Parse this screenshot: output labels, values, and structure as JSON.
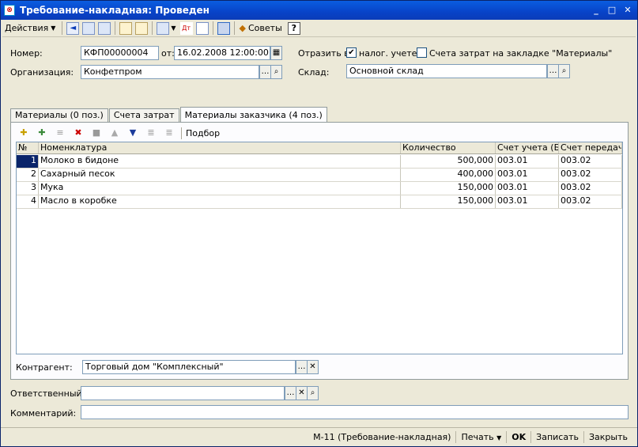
{
  "window": {
    "title": "Требование-накладная: Проведен"
  },
  "toolbar": {
    "actions_label": "Действия",
    "tips_label": "Советы",
    "help_label": "?"
  },
  "header": {
    "number_label": "Номер:",
    "number_value": "КФП00000004",
    "from_label": "от:",
    "date_value": "16.02.2008 12:00:00",
    "reflect_label": "Отразить в:",
    "tax_label": "налог. учете",
    "cost_accounts_label": "Счета затрат на закладке \"Материалы\"",
    "org_label": "Организация:",
    "org_value": "Конфетпром",
    "warehouse_label": "Склад:",
    "warehouse_value": "Основной склад"
  },
  "tabs": [
    {
      "label": "Материалы (0 поз.)"
    },
    {
      "label": "Счета затрат"
    },
    {
      "label": "Материалы заказчика (4 поз.)"
    }
  ],
  "table_toolbar": {
    "select_label": "Подбор"
  },
  "table": {
    "columns": [
      "№",
      "Номенклатура",
      "Количество",
      "Счет учета (БУ)",
      "Счет передач..."
    ],
    "rows": [
      {
        "n": "1",
        "name": "Молоко в бидоне",
        "qty": "500,000",
        "acc": "003.01",
        "trans": "003.02"
      },
      {
        "n": "2",
        "name": "Сахарный песок",
        "qty": "400,000",
        "acc": "003.01",
        "trans": "003.02"
      },
      {
        "n": "3",
        "name": "Мука",
        "qty": "150,000",
        "acc": "003.01",
        "trans": "003.02"
      },
      {
        "n": "4",
        "name": "Масло в коробке",
        "qty": "150,000",
        "acc": "003.01",
        "trans": "003.02"
      }
    ]
  },
  "counterparty": {
    "label": "Контрагент:",
    "value": "Торговый дом \"Комплексный\""
  },
  "footer": {
    "responsible_label": "Ответственный:",
    "responsible_value": "",
    "comment_label": "Комментарий:",
    "comment_value": ""
  },
  "statusbar": {
    "form_label": "М-11 (Требование-накладная)",
    "print_label": "Печать",
    "ok_label": "OK",
    "save_label": "Записать",
    "close_label": "Закрыть"
  }
}
